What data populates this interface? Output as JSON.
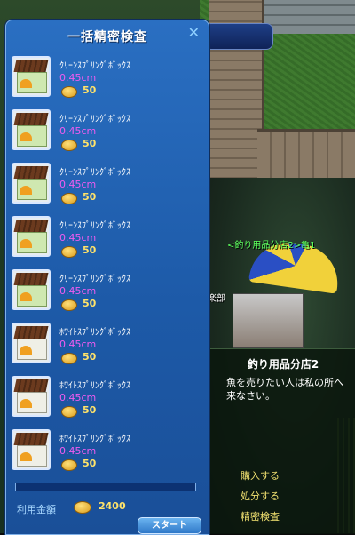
{
  "window": {
    "title": "一括精密検査",
    "close_icon": "close-icon"
  },
  "items": [
    {
      "name": "ｸﾘｰﾝｽﾌﾟﾘﾝｸﾞﾎﾞｯｸｽ",
      "size": "0.45cm",
      "price": "50",
      "variant": "green"
    },
    {
      "name": "ｸﾘｰﾝｽﾌﾟﾘﾝｸﾞﾎﾞｯｸｽ",
      "size": "0.45cm",
      "price": "50",
      "variant": "green"
    },
    {
      "name": "ｸﾘｰﾝｽﾌﾟﾘﾝｸﾞﾎﾞｯｸｽ",
      "size": "0.45cm",
      "price": "50",
      "variant": "green"
    },
    {
      "name": "ｸﾘｰﾝｽﾌﾟﾘﾝｸﾞﾎﾞｯｸｽ",
      "size": "0.45cm",
      "price": "50",
      "variant": "green"
    },
    {
      "name": "ｸﾘｰﾝｽﾌﾟﾘﾝｸﾞﾎﾞｯｸｽ",
      "size": "0.45cm",
      "price": "50",
      "variant": "green"
    },
    {
      "name": "ﾎﾜｲﾄｽﾌﾟﾘﾝｸﾞﾎﾞｯｸｽ",
      "size": "0.45cm",
      "price": "50",
      "variant": "white"
    },
    {
      "name": "ﾎﾜｲﾄｽﾌﾟﾘﾝｸﾞﾎﾞｯｸｽ",
      "size": "0.45cm",
      "price": "50",
      "variant": "white"
    },
    {
      "name": "ﾎﾜｲﾄｽﾌﾟﾘﾝｸﾞﾎﾞｯｸｽ",
      "size": "0.45cm",
      "price": "50",
      "variant": "white"
    }
  ],
  "footer": {
    "total_label": "利用金額",
    "total_value": "2400",
    "start_label": "スタート",
    "progress": 0
  },
  "world": {
    "npc_name": "<釣り用品分店2>亀1",
    "club_label": "楽部"
  },
  "npc_dialog": {
    "title": "釣り用品分店2",
    "message": "魚を売りたい人は私の所へ来なさい。",
    "options": [
      "購入する",
      "処分する",
      "精密検査"
    ]
  },
  "colors": {
    "window_bg": "#1d5aa8",
    "size_text": "#f05cf0",
    "price_text": "#ffe36a",
    "npc_option": "#f0e070",
    "npc_name": "#5cff5c"
  }
}
